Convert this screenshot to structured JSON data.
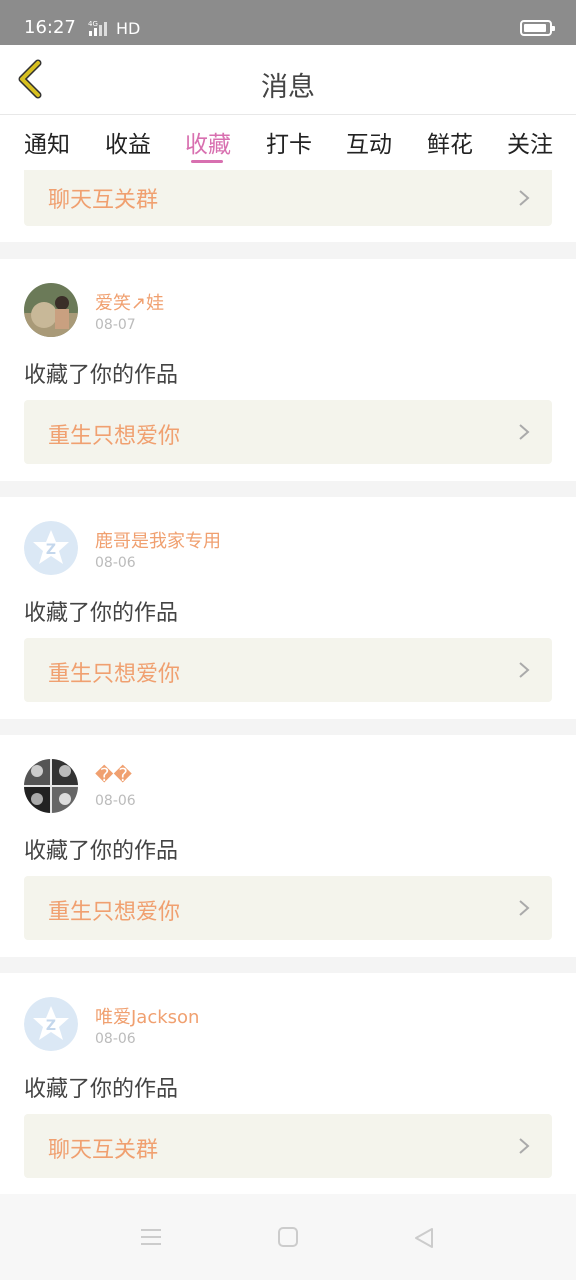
{
  "status": {
    "time": "16:27",
    "network": "4G",
    "hd": "HD"
  },
  "header": {
    "title": "消息"
  },
  "tabs": [
    {
      "label": "通知"
    },
    {
      "label": "收益"
    },
    {
      "label": "收藏",
      "active": true
    },
    {
      "label": "打卡"
    },
    {
      "label": "互动"
    },
    {
      "label": "鲜花"
    },
    {
      "label": "关注"
    }
  ],
  "partial_card": {
    "work_title": "聊天互关群"
  },
  "items": [
    {
      "user": "爱笑↗娃",
      "date": "08-07",
      "action": "收藏了你的作品",
      "work_title": "重生只想爱你",
      "avatar": "photo-avatar"
    },
    {
      "user": "鹿哥是我家专用",
      "date": "08-06",
      "action": "收藏了你的作品",
      "work_title": "重生只想爱你",
      "avatar": "default-avatar"
    },
    {
      "user": "��",
      "date": "08-06",
      "action": "收藏了你的作品",
      "work_title": "重生只想爱你",
      "avatar": "photo-avatar"
    },
    {
      "user": "唯爱Jackson",
      "date": "08-06",
      "action": "收藏了你的作品",
      "work_title": "聊天互关群",
      "avatar": "default-avatar"
    }
  ],
  "colors": {
    "accent": "#d870b0",
    "username": "#f0a070",
    "back": "#d8c020"
  }
}
